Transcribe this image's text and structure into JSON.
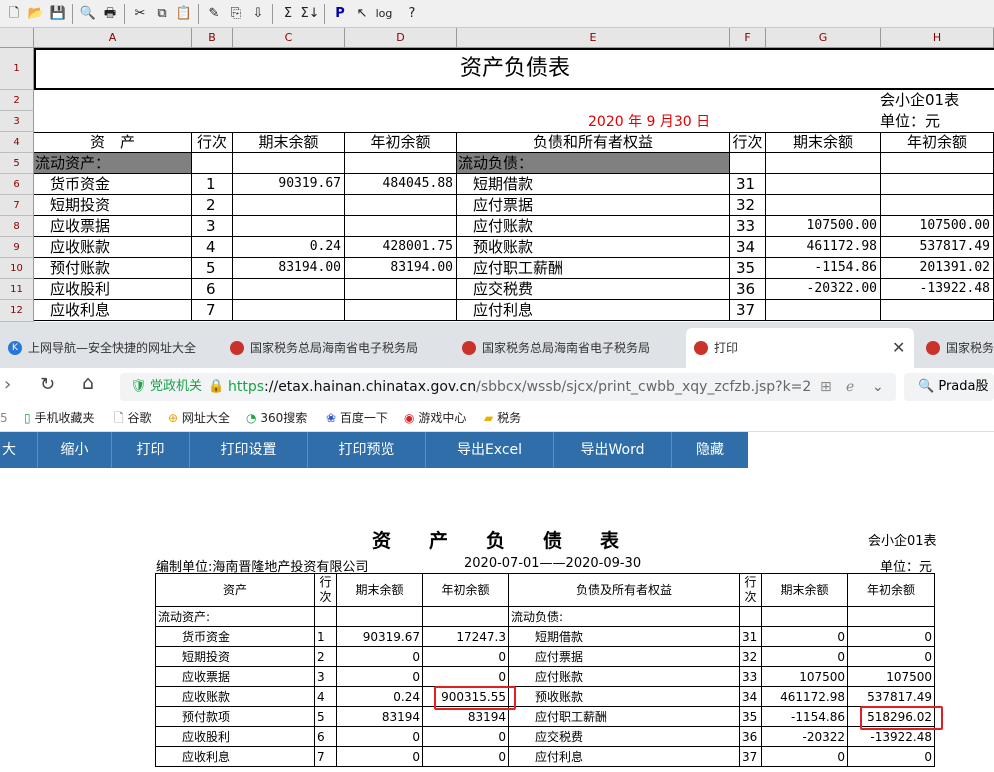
{
  "sheet": {
    "title": "资产负债表",
    "form_code": "会小企01表",
    "unit": "单位：元",
    "date": "2020 年 9 月30 日",
    "columns": [
      "A",
      "B",
      "C",
      "D",
      "E",
      "F",
      "G",
      "H"
    ],
    "rows": [
      "1",
      "2",
      "3",
      "4",
      "5",
      "6",
      "7",
      "8",
      "9",
      "10",
      "11",
      "12"
    ],
    "headers": {
      "asset": "资　产",
      "line": "行次",
      "end": "期末余额",
      "begin": "年初余额",
      "liab": "负债和所有者权益",
      "line2": "行次",
      "end2": "期末余额",
      "begin2": "年初余额"
    },
    "section_left": "流动资产：",
    "section_right": "流动负债：",
    "data": [
      {
        "a": "货币资金",
        "b": "1",
        "c": "90319.67",
        "d": "484045.88",
        "e": "短期借款",
        "f": "31",
        "g": "",
        "h": ""
      },
      {
        "a": "短期投资",
        "b": "2",
        "c": "",
        "d": "",
        "e": "应付票据",
        "f": "32",
        "g": "",
        "h": ""
      },
      {
        "a": "应收票据",
        "b": "3",
        "c": "",
        "d": "",
        "e": "应付账款",
        "f": "33",
        "g": "107500.00",
        "h": "107500.00"
      },
      {
        "a": "应收账款",
        "b": "4",
        "c": "0.24",
        "d": "428001.75",
        "e": "预收账款",
        "f": "34",
        "g": "461172.98",
        "h": "537817.49"
      },
      {
        "a": "预付账款",
        "b": "5",
        "c": "83194.00",
        "d": "83194.00",
        "e": "应付职工薪酬",
        "f": "35",
        "g": "-1154.86",
        "h": "201391.02"
      },
      {
        "a": "应收股利",
        "b": "6",
        "c": "",
        "d": "",
        "e": "应交税费",
        "f": "36",
        "g": "-20322.00",
        "h": "-13922.48"
      },
      {
        "a": "应收利息",
        "b": "7",
        "c": "",
        "d": "",
        "e": "应付利息",
        "f": "37",
        "g": "",
        "h": ""
      }
    ]
  },
  "browser": {
    "tabs": [
      {
        "label": "上网导航—安全快捷的网址大全"
      },
      {
        "label": "国家税务总局海南省电子税务局"
      },
      {
        "label": "国家税务总局海南省电子税务局"
      },
      {
        "label": "打印"
      },
      {
        "label": "国家税务"
      }
    ],
    "gov_badge": "党政机关",
    "url_scheme": "https",
    "url_host": "://etax.hainan.chinatax.gov.cn",
    "url_path": "/sbbcx/wssb/sjcx/print_cwbb_xqy_zcfzb.jsp?k=2",
    "search_text": "Prada股",
    "bookmarks": [
      "手机收藏夹",
      "谷歌",
      "网址大全",
      "360搜索",
      "百度一下",
      "游戏中心",
      "税务"
    ],
    "print_buttons": [
      "大",
      "缩小",
      "打印",
      "打印设置",
      "打印预览",
      "导出Excel",
      "导出Word",
      "隐藏"
    ]
  },
  "report": {
    "title": "资　　产　　负　　债　　表",
    "form_code": "会小企01表",
    "company": "编制单位:海南晋隆地产投资有限公司",
    "period": "2020-07-01——2020-09-30",
    "unit": "单位：元",
    "headers": {
      "asset": "资产",
      "line": "行次",
      "end": "期末余额",
      "begin": "年初余额",
      "liab": "负债及所有者权益",
      "line2": "行次",
      "end2": "期末余额",
      "begin2": "年初余额"
    },
    "section_left": "流动资产:",
    "section_right": "流动负债:",
    "data": [
      {
        "a": "货币资金",
        "b": "1",
        "c": "90319.67",
        "d": "17247.3",
        "e": "短期借款",
        "f": "31",
        "g": "0",
        "h": "0"
      },
      {
        "a": "短期投资",
        "b": "2",
        "c": "0",
        "d": "0",
        "e": "应付票据",
        "f": "32",
        "g": "0",
        "h": "0"
      },
      {
        "a": "应收票据",
        "b": "3",
        "c": "0",
        "d": "0",
        "e": "应付账款",
        "f": "33",
        "g": "107500",
        "h": "107500"
      },
      {
        "a": "应收账款",
        "b": "4",
        "c": "0.24",
        "d": "900315.55",
        "e": "预收账款",
        "f": "34",
        "g": "461172.98",
        "h": "537817.49"
      },
      {
        "a": "预付款项",
        "b": "5",
        "c": "83194",
        "d": "83194",
        "e": "应付职工薪酬",
        "f": "35",
        "g": "-1154.86",
        "h": "518296.02"
      },
      {
        "a": "应收股利",
        "b": "6",
        "c": "0",
        "d": "0",
        "e": "应交税费",
        "f": "36",
        "g": "-20322",
        "h": "-13922.48"
      },
      {
        "a": "应收利息",
        "b": "7",
        "c": "0",
        "d": "0",
        "e": "应付利息",
        "f": "37",
        "g": "0",
        "h": "0"
      }
    ]
  }
}
